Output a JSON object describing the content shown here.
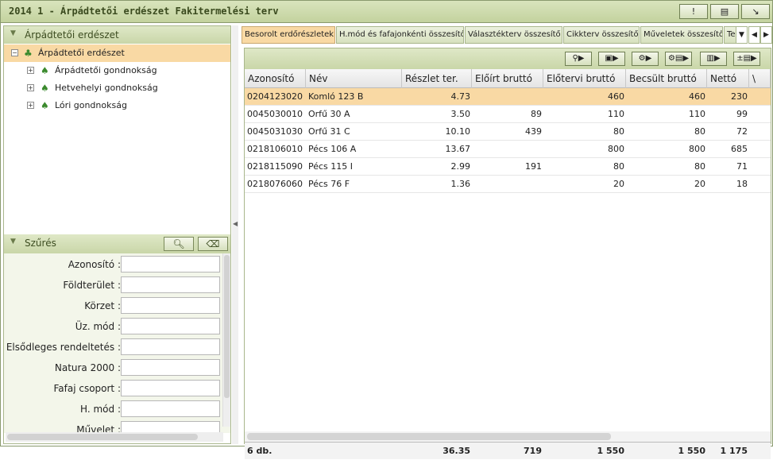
{
  "window": {
    "title": "2014 1 - Árpádtetői erdészet Fakitermelési terv",
    "buttons": [
      "!",
      "▤",
      "↘"
    ]
  },
  "tree_panel": {
    "title": "Árpádtetői erdészet",
    "root": {
      "toggle": "−",
      "label": "Árpádtetői erdészet"
    },
    "children": [
      {
        "toggle": "+",
        "label": "Árpádtetői gondnokság"
      },
      {
        "toggle": "+",
        "label": "Hetvehelyi gondnokság"
      },
      {
        "toggle": "+",
        "label": "Lóri gondnokság"
      }
    ]
  },
  "filter_panel": {
    "title": "Szűrés",
    "fields": [
      {
        "label": "Azonosító :",
        "value": ""
      },
      {
        "label": "Földterület :",
        "value": ""
      },
      {
        "label": "Körzet :",
        "value": ""
      },
      {
        "label": "Üz. mód :",
        "value": ""
      },
      {
        "label": "Elsődleges rendeltetés :",
        "value": ""
      },
      {
        "label": "Natura 2000 :",
        "value": ""
      },
      {
        "label": "Fafaj csoport :",
        "value": ""
      },
      {
        "label": "H. mód :",
        "value": ""
      },
      {
        "label": "Művelet :",
        "value": ""
      }
    ]
  },
  "tabs": [
    {
      "label": "Besorolt erdőrészletek",
      "active": true
    },
    {
      "label": "H.mód és fafajonkénti összesítő",
      "active": false
    },
    {
      "label": "Választékterv összesítő",
      "active": false
    },
    {
      "label": "Cikkterv összesítő",
      "active": false
    },
    {
      "label": "Műveletek összesítő",
      "active": false
    },
    {
      "label": "Te",
      "active": false
    }
  ],
  "tab_nav": [
    "▼",
    "◀",
    "▶"
  ],
  "grid": {
    "toolbar_buttons": [
      "⚲▶",
      "▣▶",
      "⚙▶",
      "⚙▤▶",
      "▥▶",
      "±▤▶"
    ],
    "columns": [
      "Azonosító",
      "Név",
      "Részlet ter.",
      "Előírt bruttó",
      "Előtervi bruttó",
      "Becsült bruttó",
      "Nettó",
      "\\"
    ],
    "rows": [
      {
        "id": "0204123020",
        "name": "Komló 123 B",
        "area": "4.73",
        "eloirt": "",
        "elotervi": "460",
        "becsult": "460",
        "netto": "230"
      },
      {
        "id": "0045030010",
        "name": "Orfű 30 A",
        "area": "3.50",
        "eloirt": "89",
        "elotervi": "110",
        "becsult": "110",
        "netto": "99"
      },
      {
        "id": "0045031030",
        "name": "Orfű 31 C",
        "area": "10.10",
        "eloirt": "439",
        "elotervi": "80",
        "becsult": "80",
        "netto": "72"
      },
      {
        "id": "0218106010",
        "name": "Pécs 106 A",
        "area": "13.67",
        "eloirt": "",
        "elotervi": "800",
        "becsult": "800",
        "netto": "685"
      },
      {
        "id": "0218115090",
        "name": "Pécs 115 I",
        "area": "2.99",
        "eloirt": "191",
        "elotervi": "80",
        "becsult": "80",
        "netto": "71"
      },
      {
        "id": "0218076060",
        "name": "Pécs 76 F",
        "area": "1.36",
        "eloirt": "",
        "elotervi": "20",
        "becsult": "20",
        "netto": "18"
      }
    ],
    "selected_row": 0,
    "footer": {
      "count": "6 db.",
      "area": "36.35",
      "eloirt": "719",
      "elotervi": "1 550",
      "becsult": "1 550",
      "netto": "1 175"
    }
  },
  "colors": {
    "accent": "#c3d29e",
    "selection": "#f9d9a4",
    "border": "#8a9a6e"
  }
}
